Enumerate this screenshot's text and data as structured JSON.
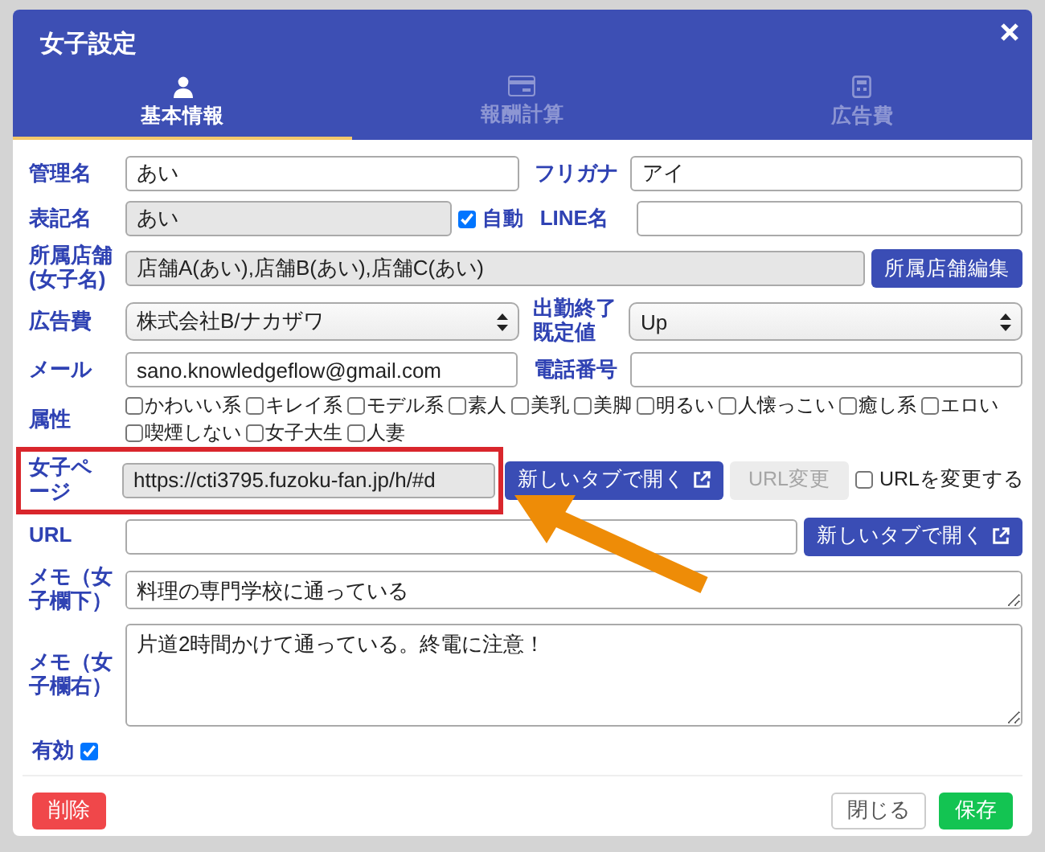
{
  "dialog": {
    "title": "女子設定"
  },
  "tabs": [
    {
      "label": "基本情報",
      "kind": "person",
      "selected": true
    },
    {
      "label": "報酬計算",
      "kind": "card",
      "selected": false
    },
    {
      "label": "広告費",
      "kind": "calculator",
      "selected": false
    }
  ],
  "form": {
    "admin_name": {
      "label": "管理名",
      "value": "あい"
    },
    "furigana": {
      "label": "フリガナ",
      "value": "アイ"
    },
    "display_name": {
      "label": "表記名",
      "value": "あい",
      "disabled": true
    },
    "auto": {
      "label": "自動",
      "checked": true
    },
    "line_name": {
      "label": "LINE名"
    },
    "stores": {
      "label": "所属店舗(女子名)",
      "value": "店舗A(あい),店舗B(あい),店舗C(あい)",
      "button": "所属店舗編集"
    },
    "ad_cost": {
      "label": "広告費",
      "value": "株式会社B/ナカザワ"
    },
    "shift_end": {
      "label": "出勤終了既定値",
      "value": "Up"
    },
    "email": {
      "label": "メール",
      "value": "sano.knowledgeflow@gmail.com"
    },
    "phone": {
      "label": "電話番号"
    },
    "attributes": {
      "label": "属性",
      "options": [
        {
          "label": "かわいい系",
          "checked": false
        },
        {
          "label": "キレイ系",
          "checked": false
        },
        {
          "label": "モデル系",
          "checked": false
        },
        {
          "label": "素人",
          "checked": false
        },
        {
          "label": "美乳",
          "checked": false
        },
        {
          "label": "美脚",
          "checked": false
        },
        {
          "label": "明るい",
          "checked": false
        },
        {
          "label": "人懐っこい",
          "checked": false
        },
        {
          "label": "癒し系",
          "checked": false
        },
        {
          "label": "エロい",
          "checked": false
        },
        {
          "label": "喫煙しない",
          "checked": false
        },
        {
          "label": "女子大生",
          "checked": false
        },
        {
          "label": "人妻",
          "checked": false
        }
      ]
    },
    "girl_page": {
      "label": "女子ページ",
      "value": "https://cti3795.fuzoku-fan.jp/h/#d",
      "open_button": "新しいタブで開く",
      "change_button": {
        "label": "URL変更",
        "disabled": true
      },
      "change_check": {
        "label": "URLを変更する",
        "checked": false
      }
    },
    "url": {
      "label": "URL",
      "open_button": "新しいタブで開く"
    },
    "memo_below": {
      "label": "メモ（女子欄下）",
      "value": "料理の専門学校に通っている"
    },
    "memo_right": {
      "label": "メモ（女子欄右）",
      "value": "片道2時間かけて通っている。終電に注意！"
    },
    "active": {
      "label": "有効",
      "checked": true
    }
  },
  "footer": {
    "delete": "削除",
    "close": "閉じる",
    "save": "保存"
  }
}
